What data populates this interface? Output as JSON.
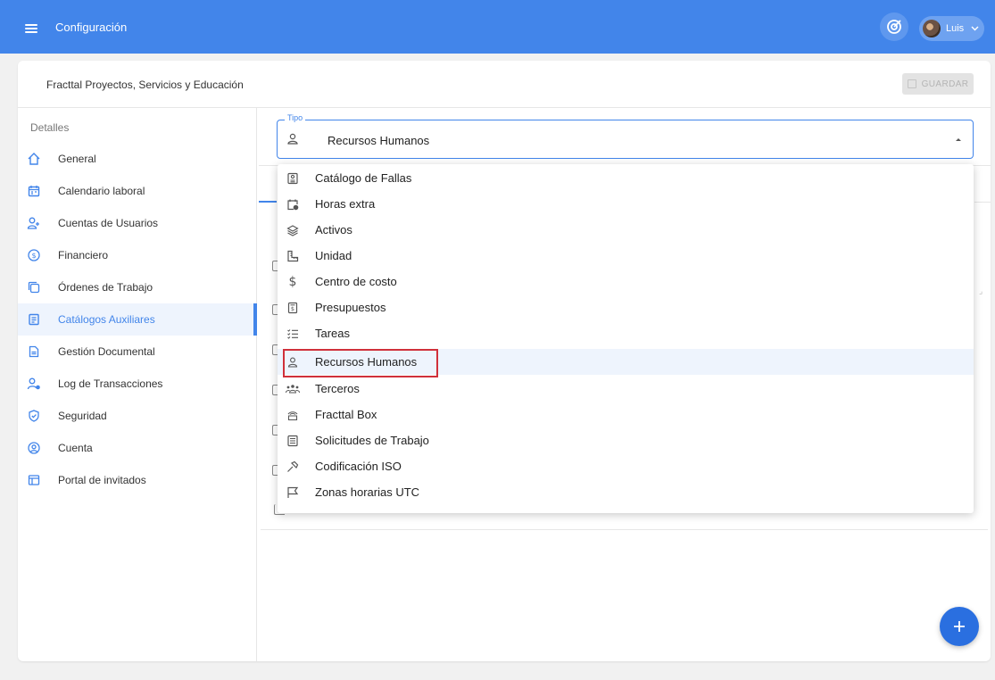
{
  "header": {
    "title": "Configuración",
    "user_name": "Luis",
    "menu_icon": "hamburger-menu-icon",
    "target_icon": "target-icon"
  },
  "toolbar": {
    "org_name": "Fracttal Proyectos, Servicios y Educación",
    "save_label": "GUARDAR"
  },
  "sidebar": {
    "heading": "Detalles",
    "items": [
      {
        "label": "General",
        "icon": "home-icon"
      },
      {
        "label": "Calendario laboral",
        "icon": "calendar-icon"
      },
      {
        "label": "Cuentas de Usuarios",
        "icon": "user-add-icon"
      },
      {
        "label": "Financiero",
        "icon": "dollar-circle-icon"
      },
      {
        "label": "Órdenes de Trabajo",
        "icon": "copy-icon"
      },
      {
        "label": "Catálogos Auxiliares",
        "icon": "catalog-icon",
        "active": true
      },
      {
        "label": "Gestión Documental",
        "icon": "document-icon"
      },
      {
        "label": "Log de Transacciones",
        "icon": "user-log-icon"
      },
      {
        "label": "Seguridad",
        "icon": "shield-icon"
      },
      {
        "label": "Cuenta",
        "icon": "account-circle-icon"
      },
      {
        "label": "Portal de invitados",
        "icon": "portal-icon"
      }
    ]
  },
  "tipo": {
    "legend": "Tipo",
    "value": "Recursos Humanos"
  },
  "dropdown": {
    "selected_index": 7,
    "options": [
      {
        "label": "Catálogo de Fallas",
        "icon": "failure-catalog-icon"
      },
      {
        "label": "Horas extra",
        "icon": "calendar-clock-icon"
      },
      {
        "label": "Activos",
        "icon": "layers-icon"
      },
      {
        "label": "Unidad",
        "icon": "ruler-icon"
      },
      {
        "label": "Centro de costo",
        "icon": "dollar-icon"
      },
      {
        "label": "Presupuestos",
        "icon": "budget-icon"
      },
      {
        "label": "Tareas",
        "icon": "checklist-icon"
      },
      {
        "label": "Recursos Humanos",
        "icon": "person-icon"
      },
      {
        "label": "Terceros",
        "icon": "people-icon"
      },
      {
        "label": "Fracttal Box",
        "icon": "router-icon"
      },
      {
        "label": "Solicitudes de Trabajo",
        "icon": "form-icon"
      },
      {
        "label": "Codificación ISO",
        "icon": "hammer-icon"
      },
      {
        "label": "Zonas horarias UTC",
        "icon": "flag-icon"
      }
    ]
  },
  "colors": {
    "primary": "#4285ea",
    "highlight_border": "#d0303a",
    "fab": "#2a6fe0"
  }
}
